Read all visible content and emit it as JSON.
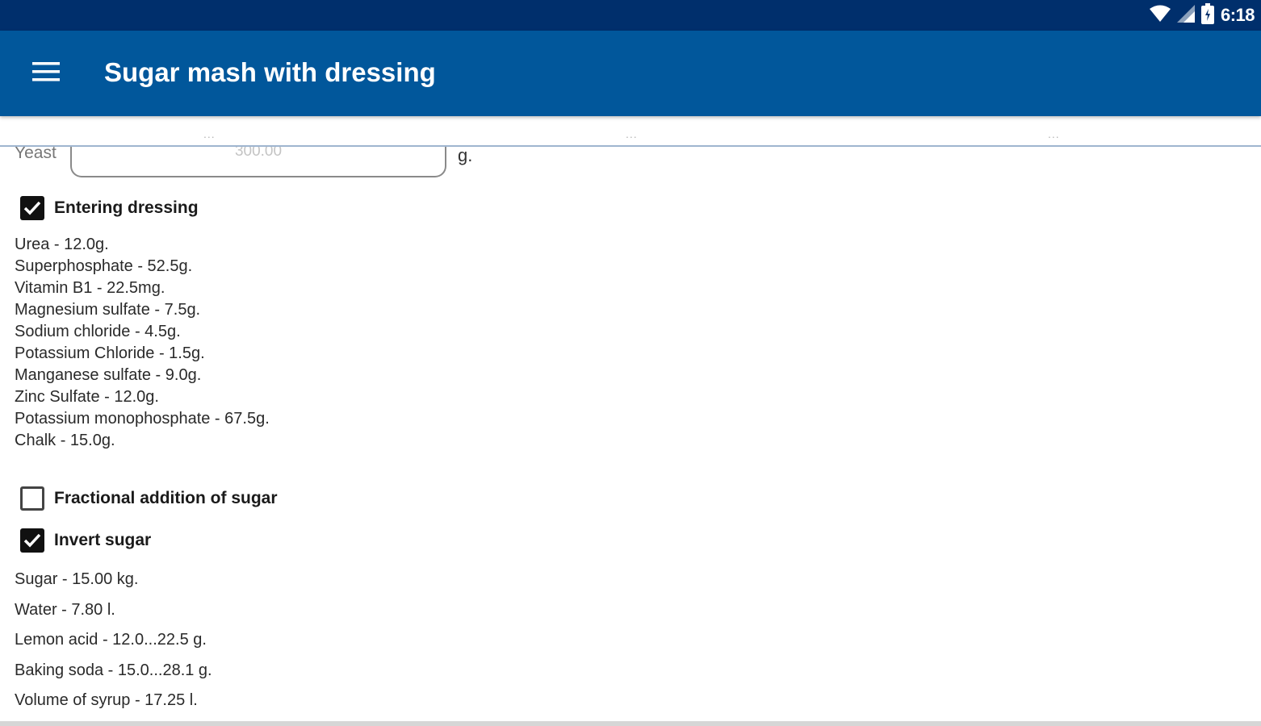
{
  "status_bar": {
    "time": "6:18",
    "icons": [
      "wifi-icon",
      "signal-icon",
      "battery-icon"
    ]
  },
  "app_bar": {
    "menu_icon": "menu-icon",
    "title": "Sugar mash with dressing",
    "background": "#01579b"
  },
  "tab_dots": [
    "...",
    "...",
    "..."
  ],
  "yeast": {
    "label": "Yeast",
    "value": "300.00",
    "unit": "g."
  },
  "dressing": {
    "label": "Entering dressing",
    "checked": true,
    "items": [
      "Urea - 12.0g.",
      "Superphosphate - 52.5g.",
      "Vitamin B1 - 22.5mg.",
      "Magnesium sulfate - 7.5g.",
      "Sodium chloride - 4.5g.",
      "Potassium Chloride - 1.5g.",
      "Manganese sulfate - 9.0g.",
      "Zinc Sulfate - 12.0g.",
      "Potassium monophosphate - 67.5g.",
      "Chalk - 15.0g."
    ]
  },
  "fractional": {
    "label": "Fractional addition of sugar",
    "checked": false
  },
  "invert_sugar": {
    "label": "Invert sugar",
    "checked": true,
    "items": [
      "Sugar -  15.00 kg.",
      "Water -  7.80 l.",
      "Lemon acid -  12.0...22.5 g.",
      "Baking soda -  15.0...28.1 g.",
      "Volume of syrup -  17.25 l."
    ]
  }
}
